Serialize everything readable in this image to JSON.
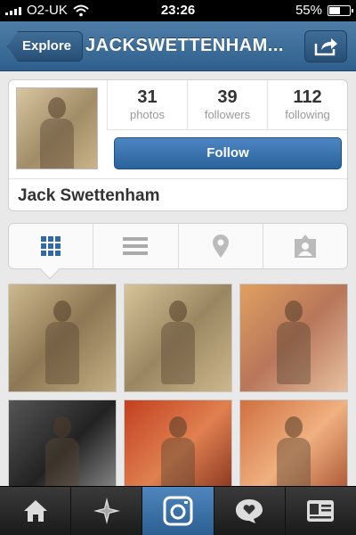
{
  "status_bar": {
    "carrier": "O2-UK",
    "time": "23:26",
    "battery": "55%",
    "battery_level": 0.55
  },
  "nav": {
    "back_label": "Explore",
    "title": "JACKSWETTENHAM...",
    "share_icon": "share-icon"
  },
  "profile": {
    "stats": [
      {
        "value": "31",
        "label": "photos"
      },
      {
        "value": "39",
        "label": "followers"
      },
      {
        "value": "112",
        "label": "following"
      }
    ],
    "follow_label": "Follow",
    "name": "Jack Swettenham"
  },
  "view_tabs": [
    "grid-icon",
    "list-icon",
    "map-pin-icon",
    "tagged-photos-icon"
  ],
  "photos": [
    "photo-1",
    "photo-2",
    "photo-3",
    "photo-4",
    "photo-5",
    "photo-6"
  ],
  "tab_bar": [
    "home-icon",
    "explore-icon",
    "camera-icon",
    "news-icon",
    "profile-icon"
  ],
  "colors": {
    "nav_blue": "#3a6a96",
    "follow_blue": "#2f6aa8",
    "active_tab": "#3b73aa"
  }
}
